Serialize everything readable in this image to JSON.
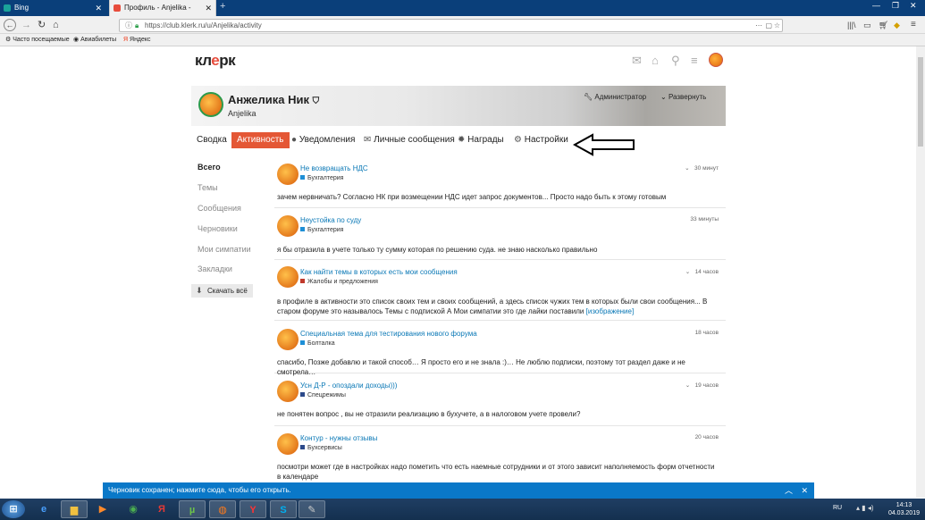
{
  "browser": {
    "tabs": [
      {
        "title": "Bing",
        "active": false
      },
      {
        "title": "Профиль - Anjelika - «Клерк»",
        "active": true
      }
    ],
    "url": "https://club.klerk.ru/u/Anjelika/activity",
    "bookmarks": [
      "Часто посещаемые",
      "Авиабилеты",
      "Яндекс"
    ]
  },
  "site": {
    "logo_left": "кл",
    "logo_mid": "е",
    "logo_right": "рк"
  },
  "profile": {
    "name": "Анжелика Ник",
    "login": "Anjelika",
    "admin_label": "Администратор",
    "expand_label": "Развернуть"
  },
  "tabs": [
    "Сводка",
    "Активность",
    "Уведомления",
    "Личные сообщения",
    "Награды",
    "Настройки"
  ],
  "left_nav": {
    "items": [
      "Всего",
      "Темы",
      "Сообщения",
      "Черновики",
      "Мои симпатии",
      "Закладки"
    ],
    "download_label": "Скачать всё"
  },
  "posts": [
    {
      "title": "Не возвращать НДС",
      "category": "Бухгалтерия",
      "cat_color": "#1e8fd6",
      "time": "30 минут",
      "body": "зачем нервничать? Согласно НК при возмещении НДС идет запрос документов... Просто надо быть к этому готовым",
      "link": ""
    },
    {
      "title": "Неустойка по суду",
      "category": "Бухгалтерия",
      "cat_color": "#1e8fd6",
      "time": "33 минуты",
      "body": "я бы отразила в учете только ту сумму которая по решению суда. не знаю насколько правильно",
      "link": ""
    },
    {
      "title": "Как найти темы в которых есть мои сообщения",
      "category": "Жалобы и предложения",
      "cat_color": "#c0392b",
      "time": "14 часов",
      "body": "в профиле в активности это список своих тем и своих сообщений, а здесь список чужих тем в которых были свои сообщения... В старом форуме это называлось Темы с подпиской А Мои симпатии это где лайки поставили",
      "link": "[изображение]"
    },
    {
      "title": "Специальная тема для тестирования нового форума",
      "category": "Болталка",
      "cat_color": "#1e8fd6",
      "time": "18 часов",
      "body": "спасибо, Позже добавлю и такой способ… Я просто его и не знала :)… Не люблю подписки, поэтому тот раздел даже и не смотрела…",
      "link": ""
    },
    {
      "title": "Усн Д-Р - опоздали доходы)))",
      "category": "Спецрежимы",
      "cat_color": "#2c4a8a",
      "time": "19 часов",
      "body": "не понятен вопрос , вы не отразили реализацию в бухучете, а в налоговом учете провели?",
      "link": ""
    },
    {
      "title": "Контур - нужны отзывы",
      "category": "Бухсервисы",
      "cat_color": "#2c4a8a",
      "time": "20 часов",
      "body": "посмотри может где в настройках надо пометить что есть наемные сотрудники и от этого зависит наполняемость форм отчетности в календаре",
      "link": ""
    }
  ],
  "notice": "Черновик сохранен; нажмите сюда, чтобы его открыть.",
  "taskbar": {
    "lang": "RU",
    "time": "14:13",
    "date": "04.03.2019"
  },
  "colors": {
    "accent": "#e45735",
    "link": "#0a78b6",
    "notice": "#0a78c8"
  }
}
